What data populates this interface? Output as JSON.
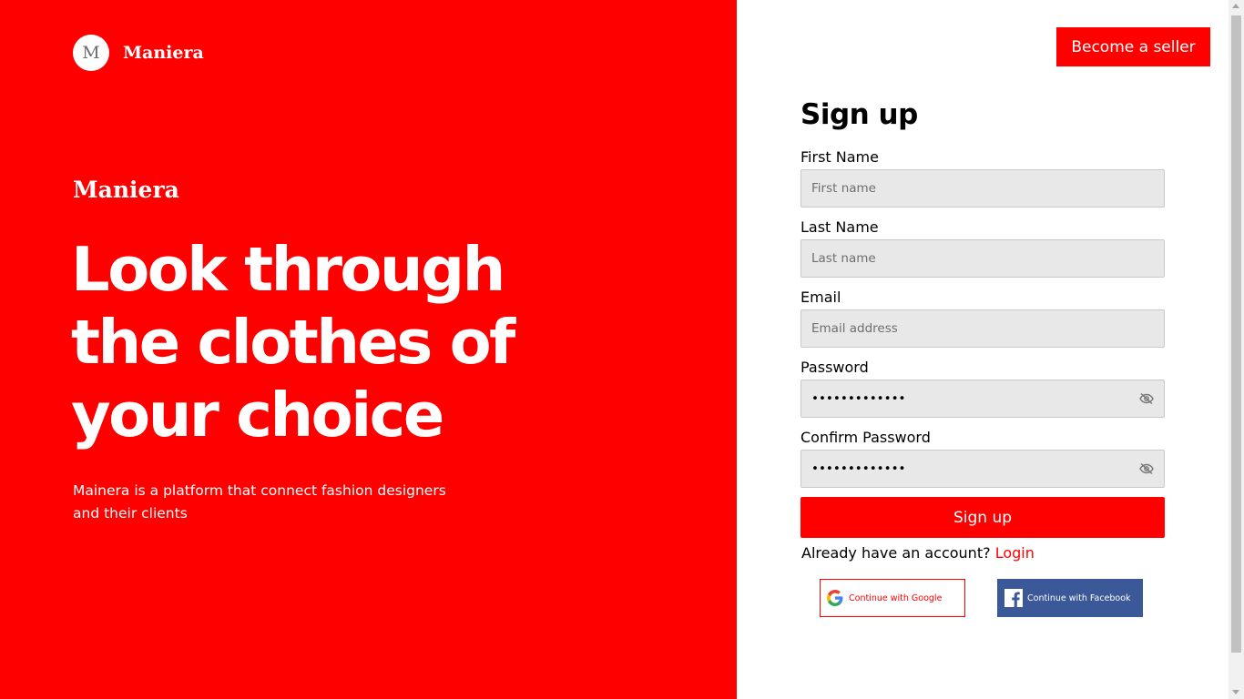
{
  "brand": {
    "logo_letter": "M",
    "name": "Maniera"
  },
  "hero": {
    "brand": "Maniera",
    "title_lines": [
      "Look through",
      "the clothes of",
      "your choice"
    ],
    "subtitle_lines": [
      "Mainera is a platform that connect fashion designers",
      "and their clients"
    ]
  },
  "header": {
    "become_seller_label": "Become a seller"
  },
  "form": {
    "title": "Sign up",
    "fields": [
      {
        "label": "First Name",
        "placeholder": "First name",
        "value": ""
      },
      {
        "label": "Last Name",
        "placeholder": "Last name",
        "value": ""
      },
      {
        "label": "Email",
        "placeholder": "Email address",
        "value": ""
      },
      {
        "label": "Password",
        "placeholder": "",
        "value": "•••••••••••••"
      },
      {
        "label": "Confirm Password",
        "placeholder": "",
        "value": "•••••••••••••"
      }
    ],
    "submit_label": "Sign up",
    "login_prompt": "Already have an account?",
    "login_link": "Login",
    "google_label": "Continue with Google",
    "facebook_label": "Continue with Facebook"
  },
  "colors": {
    "brand_red": "#ff0000",
    "facebook_blue": "#3b5998",
    "input_bg": "#e8e8e8"
  },
  "icons": {
    "password_toggle": "eye-off-icon",
    "google": "google-icon",
    "facebook": "facebook-icon"
  }
}
